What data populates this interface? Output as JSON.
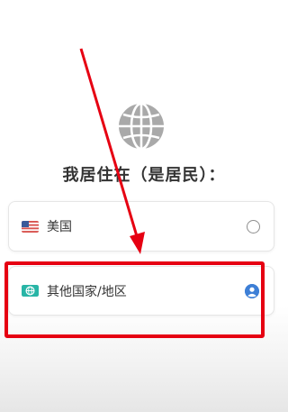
{
  "prompt": {
    "title": "我居住在（是居民）："
  },
  "options": [
    {
      "label": "美国",
      "icon": "us-flag-icon",
      "selected": false
    },
    {
      "label": "其他国家/地区",
      "icon": "globe-badge-icon",
      "selected": true
    }
  ],
  "colors": {
    "accent": "#3d7fd6",
    "annotation": "#e60012",
    "text": "#333333",
    "globe": "#a9a9a9"
  }
}
